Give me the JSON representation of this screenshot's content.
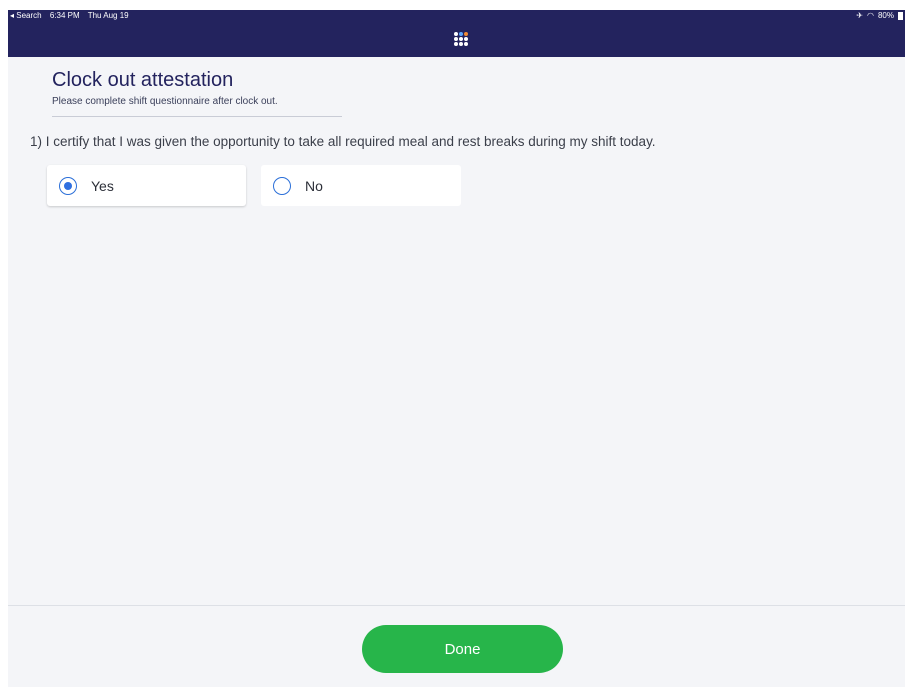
{
  "status_bar": {
    "back_label": "◂ Search",
    "time": "6:34 PM",
    "date": "Thu Aug 19",
    "battery": "80%"
  },
  "page": {
    "title": "Clock out attestation",
    "subtitle": "Please complete shift questionnaire after clock out."
  },
  "questions": [
    {
      "text": "1) I certify that I was given the opportunity to take all required meal and rest breaks during my shift today.",
      "options": [
        {
          "label": "Yes",
          "selected": true
        },
        {
          "label": "No",
          "selected": false
        }
      ]
    }
  ],
  "footer": {
    "done_label": "Done"
  },
  "colors": {
    "header_bg": "#23235e",
    "accent_blue": "#2f6fe0",
    "done_green": "#27b54a"
  }
}
